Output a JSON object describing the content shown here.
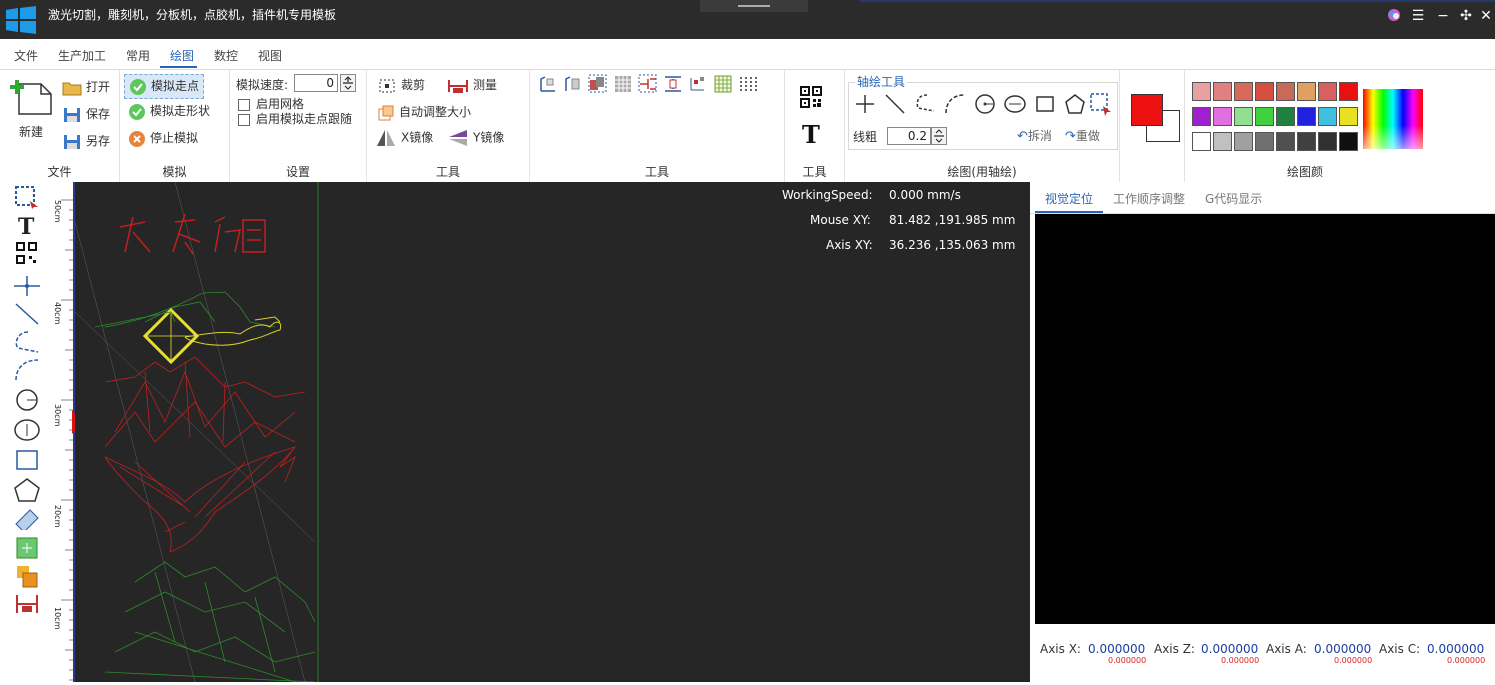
{
  "window": {
    "title": "激光切割，雕刻机，分板机，点胶机，插件机专用模板"
  },
  "menu": [
    "文件",
    "生产加工",
    "常用",
    "绘图",
    "数控",
    "视图"
  ],
  "ribbon": {
    "file": {
      "new": "新建",
      "open": "打开",
      "save": "保存",
      "save_as": "另存",
      "label": "文件"
    },
    "sim": {
      "step": "模拟走点",
      "shape": "模拟走形状",
      "stop": "停止模拟",
      "label": "模拟"
    },
    "settings": {
      "speed_label": "模拟速度:",
      "speed_value": "0",
      "grid": "启用网格",
      "follow": "启用模拟走点跟随",
      "label": "设置"
    },
    "tools1": {
      "crop": "裁剪",
      "measure": "测量",
      "auto_resize": "自动调整大小",
      "x_mirror": "X镜像",
      "y_mirror": "Y镜像",
      "label": "工具"
    },
    "tools2": {
      "label": "工具"
    },
    "tools3": {
      "label": "工具"
    },
    "axis_draw": {
      "header": "轴绘工具",
      "line_width_label": "线粗",
      "line_width": "0.2",
      "undo": "拆消",
      "redo": "重做",
      "label": "绘图(用轴绘)"
    },
    "colors": {
      "label": "绘图颜",
      "primary": "#ee1111"
    }
  },
  "palette": [
    [
      "#e8a0a0",
      "#e08080",
      "#d86a5a",
      "#d65040",
      "#c86a5a",
      "#e0a060",
      "#d86060",
      "#e81010"
    ],
    [
      "#a020d0",
      "#e070e0",
      "#90e090",
      "#40d040",
      "#208040",
      "#2020e0",
      "#40c0e0",
      "#e8e020"
    ],
    [
      "#ffffff",
      "#c0c0c0",
      "#a0a0a0",
      "#707070",
      "#505050",
      "#404040",
      "#303030",
      "#101010"
    ]
  ],
  "canvas": {
    "speed_label": "WorkingSpeed:",
    "speed_value": "0.000 mm/s",
    "mouse_label": "Mouse XY:",
    "mouse_value": "81.482 ,191.985 mm",
    "axis_label": "Axis XY:",
    "axis_value": "36.236 ,135.063 mm",
    "ruler_ticks": [
      "50cm",
      "40cm",
      "30cm",
      "20cm",
      "10cm"
    ]
  },
  "right_panel": {
    "tabs": [
      "视觉定位",
      "工作顺序调整",
      "G代码显示"
    ],
    "axes": [
      {
        "label": "Axis X:",
        "value": "0.000000",
        "sub": "0.000000"
      },
      {
        "label": "Axis Z:",
        "value": "0.000000",
        "sub": "0.000000"
      },
      {
        "label": "Axis A:",
        "value": "0.000000",
        "sub": "0.000000"
      },
      {
        "label": "Axis C:",
        "value": "0.000000",
        "sub": "0.000000"
      }
    ]
  }
}
